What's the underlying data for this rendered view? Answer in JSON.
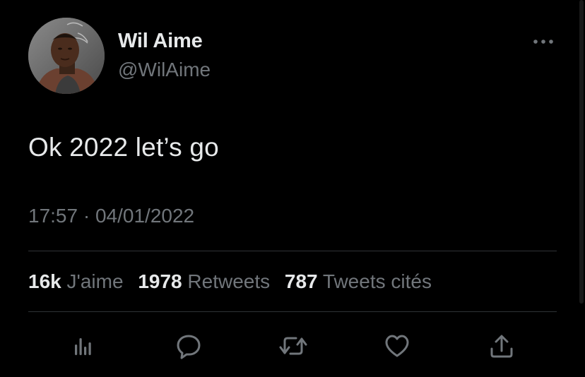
{
  "author": {
    "name": "Wil Aime",
    "handle": "@WilAime"
  },
  "tweet": {
    "text": "Ok 2022 let’s go",
    "time": "17:57",
    "separator": " · ",
    "date": "04/01/2022"
  },
  "stats": [
    {
      "count": "16k",
      "label": "J'aime"
    },
    {
      "count": "1978",
      "label": "Retweets"
    },
    {
      "count": "787",
      "label": "Tweets cités"
    }
  ],
  "actions": [
    "analytics-icon",
    "reply-icon",
    "retweet-icon",
    "like-icon",
    "share-icon"
  ],
  "colors": {
    "background": "#000000",
    "primary_text": "#e7e9ea",
    "secondary_text": "#71767b",
    "divider": "#2f3336"
  }
}
